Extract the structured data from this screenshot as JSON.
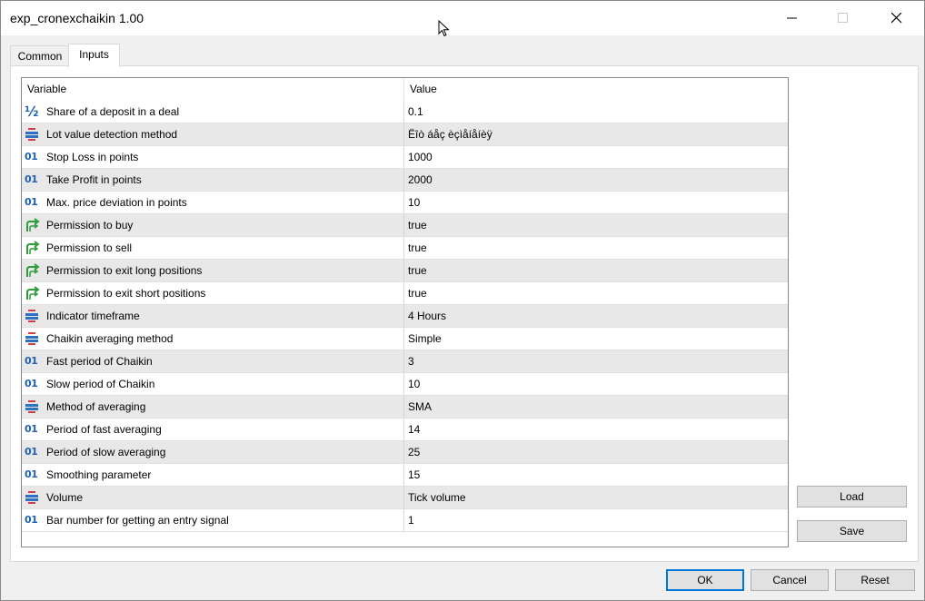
{
  "window": {
    "title": "exp_cronexchaikin 1.00"
  },
  "tabs": [
    {
      "label": "Common",
      "active": false
    },
    {
      "label": "Inputs",
      "active": true
    }
  ],
  "grid": {
    "headers": {
      "variable": "Variable",
      "value": "Value"
    },
    "rows": [
      {
        "icon": "fraction-icon",
        "variable": "Share of a deposit in a deal",
        "value": "0.1"
      },
      {
        "icon": "enum-icon",
        "variable": "Lot value detection method",
        "value": "Ëîò áåç èçìåíåíèÿ"
      },
      {
        "icon": "integer-icon",
        "variable": "Stop Loss in points",
        "value": "1000"
      },
      {
        "icon": "integer-icon",
        "variable": "Take Profit in points",
        "value": "2000"
      },
      {
        "icon": "integer-icon",
        "variable": "Max. price deviation in points",
        "value": "10"
      },
      {
        "icon": "bool-icon",
        "variable": "Permission to buy",
        "value": "true"
      },
      {
        "icon": "bool-icon",
        "variable": "Permission to sell",
        "value": "true"
      },
      {
        "icon": "bool-icon",
        "variable": "Permission to exit long positions",
        "value": "true"
      },
      {
        "icon": "bool-icon",
        "variable": "Permission to exit short positions",
        "value": "true"
      },
      {
        "icon": "enum-icon",
        "variable": "Indicator timeframe",
        "value": "4 Hours"
      },
      {
        "icon": "enum-icon",
        "variable": "Chaikin averaging method",
        "value": "Simple"
      },
      {
        "icon": "integer-icon",
        "variable": "Fast period of Chaikin",
        "value": "3"
      },
      {
        "icon": "integer-icon",
        "variable": "Slow period of Chaikin",
        "value": "10"
      },
      {
        "icon": "enum-icon",
        "variable": "Method of averaging",
        "value": "SMA"
      },
      {
        "icon": "integer-icon",
        "variable": "Period of fast averaging",
        "value": "14"
      },
      {
        "icon": "integer-icon",
        "variable": "Period of slow averaging",
        "value": "25"
      },
      {
        "icon": "integer-icon",
        "variable": "Smoothing parameter",
        "value": "15"
      },
      {
        "icon": "enum-icon",
        "variable": "Volume",
        "value": "Tick volume"
      },
      {
        "icon": "integer-icon",
        "variable": "Bar number for getting an entry signal",
        "value": "1"
      }
    ]
  },
  "side_buttons": {
    "load": "Load",
    "save": "Save"
  },
  "footer_buttons": {
    "ok": "OK",
    "cancel": "Cancel",
    "reset": "Reset"
  },
  "icon_glyphs": {
    "fraction": "½",
    "integer": "01"
  },
  "colors": {
    "accent": "#0078d7",
    "integer_icon": "#2060b0",
    "bool_icon": "#2e9c3a",
    "enum_icon_top": "#d04040",
    "enum_icon_bottom": "#3070c0"
  }
}
